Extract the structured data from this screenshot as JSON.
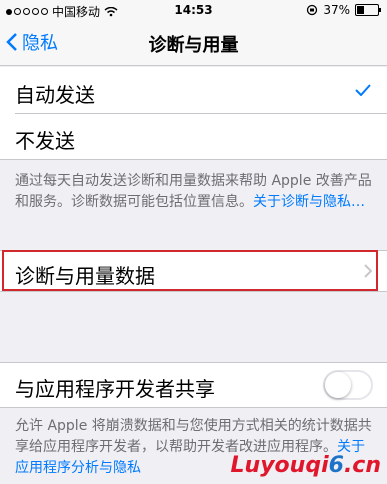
{
  "status_bar": {
    "carrier": "中国移动",
    "time": "14:53",
    "battery": "37%",
    "battery_level": 0.37
  },
  "nav": {
    "back_label": "隐私",
    "title": "诊断与用量"
  },
  "send_options": [
    {
      "label": "自动发送",
      "selected": true
    },
    {
      "label": "不发送",
      "selected": false
    }
  ],
  "send_footer": {
    "text": "通过每天自动发送诊断和用量数据来帮助 Apple 改善产品和服务。诊断数据可能包括位置信息。",
    "link": "关于诊断与隐私…"
  },
  "data_row": {
    "label": "诊断与用量数据"
  },
  "share_row": {
    "label": "与应用程序开发者共享",
    "enabled": false
  },
  "share_footer": {
    "text": "允许 Apple 将崩溃数据和与您使用方式相关的统计数据共享给应用程序开发者，以帮助开发者改进应用程序。",
    "link": "关于应用程序分析与隐私"
  },
  "watermark": {
    "text_red": "Luyouqi",
    "text_blue": "6",
    "text_red2": ".cn"
  },
  "colors": {
    "accent": "#007aff",
    "highlight": "#d0282c",
    "background": "#efeff4"
  }
}
